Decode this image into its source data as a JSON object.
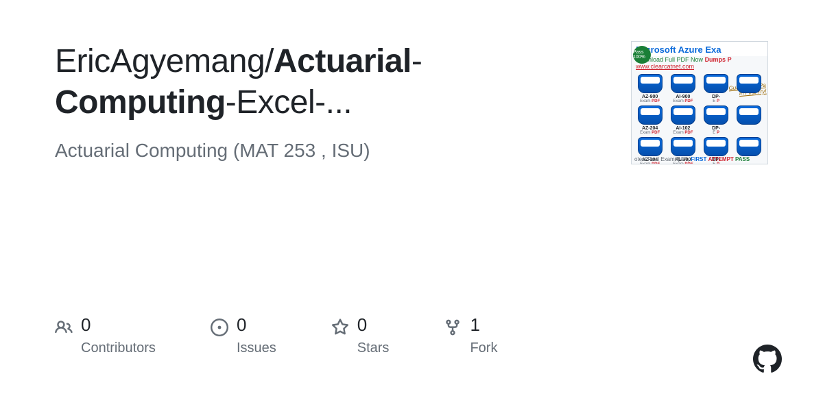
{
  "repo": {
    "owner": "EricAgyemang",
    "separator": "/",
    "name_part1": "Actuarial",
    "name_part2": "-",
    "name_part3": "Computing",
    "name_part4": "-Excel-...",
    "description": "Actuarial Computing (MAT 253 , ISU)"
  },
  "stats": [
    {
      "value": "0",
      "label": "Contributors"
    },
    {
      "value": "0",
      "label": "Issues"
    },
    {
      "value": "0",
      "label": "Stars"
    },
    {
      "value": "1",
      "label": "Fork"
    }
  ],
  "thumb": {
    "header": "Microsoft Azure Exa",
    "download": "Download Full PDF Now",
    "url": "www.clearcatnet.com",
    "dumps": "Dumps P",
    "pass_badge": "Pass 100%",
    "guarantee_l1": "Guaranteed Pa",
    "guarantee_l2": "In First Try!",
    "certs": [
      {
        "code": "AZ-900",
        "exam": "Exam",
        "pdf": "PDF"
      },
      {
        "code": "AI-900",
        "exam": "Exam",
        "pdf": "PDF"
      },
      {
        "code": "DP-",
        "exam": "E",
        "pdf": "P"
      },
      {
        "code": "",
        "exam": "",
        "pdf": ""
      },
      {
        "code": "AZ-204",
        "exam": "Exam",
        "pdf": "PDF"
      },
      {
        "code": "AI-102",
        "exam": "Exam",
        "pdf": "PDF"
      },
      {
        "code": "DP-",
        "exam": "E",
        "pdf": "P"
      },
      {
        "code": "",
        "exam": "",
        "pdf": ""
      },
      {
        "code": "AZ-104",
        "exam": "Exam",
        "pdf": "PDF"
      },
      {
        "code": "PL-300",
        "exam": "Exam",
        "pdf": "PDF"
      },
      {
        "code": "DP-",
        "exam": "E",
        "pdf": "P"
      },
      {
        "code": "",
        "exam": "",
        "pdf": ""
      }
    ],
    "footer_prefix": "otest Real Exam Q&A,",
    "footer_first": "FIRST",
    "footer_attempt": "ATTEMPT",
    "footer_pass": "PASS"
  }
}
